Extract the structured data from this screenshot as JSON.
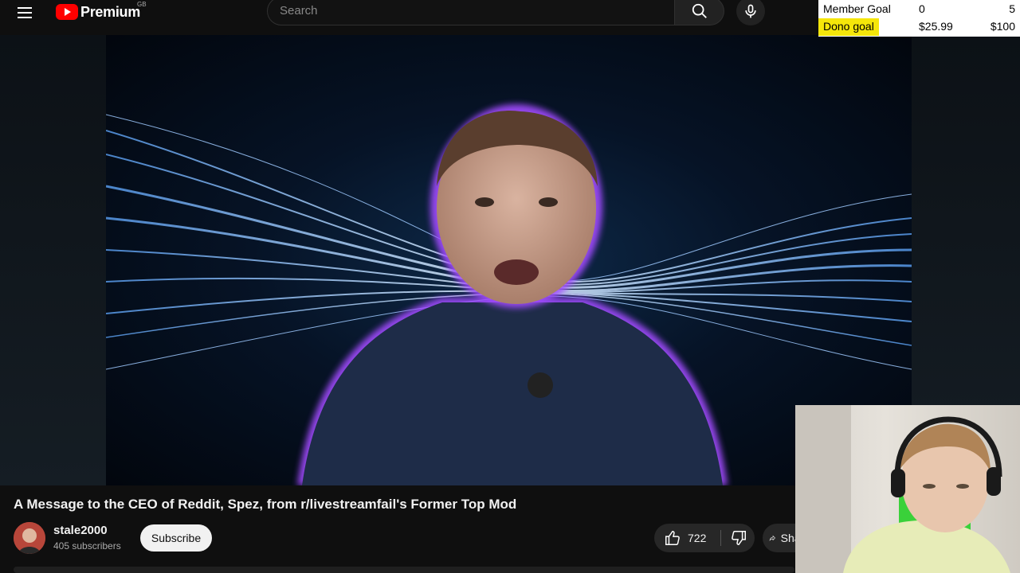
{
  "header": {
    "logo_text": "Premium",
    "region": "GB",
    "search_placeholder": "Search"
  },
  "goals": {
    "member": {
      "label": "Member Goal",
      "current": "0",
      "target": "5"
    },
    "dono": {
      "label": "Dono goal",
      "current": "$25.99",
      "target": "$100"
    }
  },
  "video": {
    "title": "A Message to the CEO of Reddit, Spez, from r/livestreamfail's Former Top Mod",
    "channel": {
      "name": "stale2000",
      "subscribers": "405 subscribers"
    },
    "subscribe_label": "Subscribe",
    "likes": "722",
    "share_label": "Share"
  },
  "colors": {
    "background": "#0f0f0f",
    "brand_red": "#ff0000",
    "goal_highlight": "#f5e60a",
    "avatar_glow": "#a24cff"
  },
  "icons": {
    "menu": "hamburger-icon",
    "search": "search-icon",
    "mic": "mic-icon",
    "like": "thumbs-up-icon",
    "dislike": "thumbs-down-icon",
    "share": "share-arrow-icon"
  }
}
